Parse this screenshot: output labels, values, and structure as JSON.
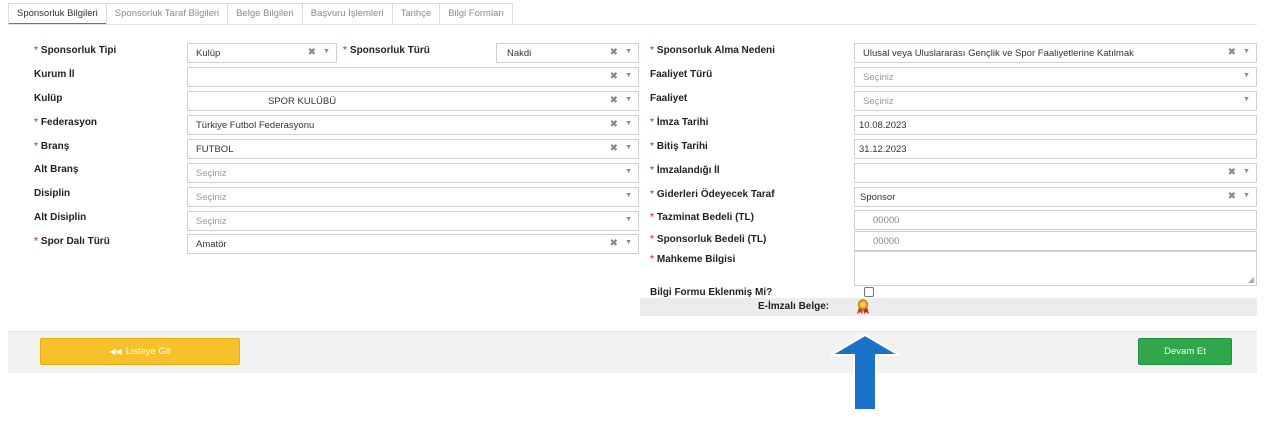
{
  "tabs": [
    {
      "label": "Sponsorluk Bilgileri",
      "active": true
    },
    {
      "label": "Sponsorluk Taraf Bilgileri"
    },
    {
      "label": "Belge Bilgileri"
    },
    {
      "label": "Başvuru İşlemleri"
    },
    {
      "label": "Tarihçe"
    },
    {
      "label": "Bilgi Formları"
    }
  ],
  "left": {
    "sponsorluk_tipi": {
      "label": "Sponsorluk Tipi",
      "value": "Kulüp"
    },
    "sponsorluk_turu": {
      "label": "Sponsorluk Türü",
      "value": "Nakdi"
    },
    "kurum_il": {
      "label": "Kurum İl",
      "value": ""
    },
    "kulup": {
      "label": "Kulüp",
      "value": "SPOR KULÜBÜ"
    },
    "federasyon": {
      "label": "Federasyon",
      "value": "Türkiye Futbol Federasyonu"
    },
    "brans": {
      "label": "Branş",
      "value": "FUTBOL"
    },
    "alt_brans": {
      "label": "Alt Branş",
      "placeholder": "Seçiniz"
    },
    "disiplin": {
      "label": "Disiplin",
      "placeholder": "Seçiniz"
    },
    "alt_disiplin": {
      "label": "Alt Disiplin",
      "placeholder": "Seçiniz"
    },
    "spor_dali_turu": {
      "label": "Spor Dalı Türü",
      "value": "Amatör"
    }
  },
  "right": {
    "alma_nedeni": {
      "label": "Sponsorluk Alma Nedeni",
      "value": "Ulusal veya Uluslararası Gençlik ve Spor Faaliyetlerine Katılmak"
    },
    "faaliyet_turu": {
      "label": "Faaliyet Türü",
      "placeholder": "Seçiniz"
    },
    "faaliyet": {
      "label": "Faaliyet",
      "placeholder": "Seçiniz"
    },
    "imza_tarihi": {
      "label": "İmza Tarihi",
      "value": "10.08.2023"
    },
    "bitis_tarihi": {
      "label": "Bitiş Tarihi",
      "value": "31.12.2023"
    },
    "imzalandigi_il": {
      "label": "İmzalandığı İl",
      "value": ""
    },
    "giderleri_odeyecek": {
      "label": "Giderleri Ödeyecek Taraf",
      "value": "Sponsor"
    },
    "tazminat_bedeli": {
      "label": "Tazminat Bedeli (TL)",
      "value": "00000"
    },
    "sponsorluk_bedeli": {
      "label": "Sponsorluk Bedeli (TL)",
      "value": "00000"
    },
    "mahkeme_bilgisi": {
      "label": "Mahkeme Bilgisi",
      "value": ""
    },
    "bilgi_formu": {
      "label": "Bilgi Formu Eklenmiş Mi?"
    },
    "e_imzali_belge": {
      "label": "E-İmzalı Belge:",
      "icon": "ribbon-badge-icon"
    }
  },
  "footer": {
    "back_label": "Listeye Git",
    "back_icon": "double-arrow-left-icon",
    "next_label": "Devam Et"
  },
  "colors": {
    "required": "#d9534f",
    "back_button": "#f6c12b",
    "next_button": "#2ea84a",
    "annotation_arrow": "#1a73c9"
  }
}
